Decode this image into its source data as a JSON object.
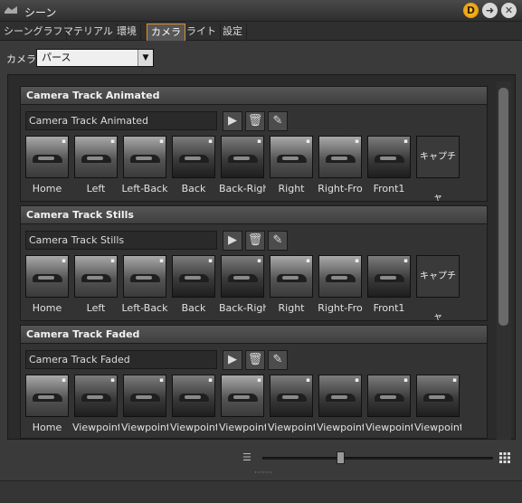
{
  "window": {
    "title": "シーン",
    "help_badge": "D",
    "next_glyph": "➜",
    "close_glyph": "✕"
  },
  "tabs": [
    {
      "label": "シーングラフ"
    },
    {
      "label": "マテリアル"
    },
    {
      "label": "環境"
    },
    {
      "label": "カメラ"
    },
    {
      "label": "ライト"
    },
    {
      "label": "設定"
    }
  ],
  "active_tab": "カメラ",
  "camera": {
    "label": "カメラ",
    "selected": "パース"
  },
  "groups": [
    {
      "title": "Camera Track Animated",
      "track_name": "Camera Track Animated",
      "thumbnails": [
        {
          "label": "Home"
        },
        {
          "label": "Left"
        },
        {
          "label": "Left-Back"
        },
        {
          "label": "Back"
        },
        {
          "label": "Back-Righ"
        },
        {
          "label": "Right"
        },
        {
          "label": "Right-Fro"
        },
        {
          "label": "Front1"
        }
      ],
      "capture_label": "キャプチャ"
    },
    {
      "title": "Camera Track Stills",
      "track_name": "Camera Track Stills",
      "thumbnails": [
        {
          "label": "Home"
        },
        {
          "label": "Left"
        },
        {
          "label": "Left-Back"
        },
        {
          "label": "Back"
        },
        {
          "label": "Back-Righ"
        },
        {
          "label": "Right"
        },
        {
          "label": "Right-Fro"
        },
        {
          "label": "Front1"
        }
      ],
      "capture_label": "キャプチャ"
    },
    {
      "title": "Camera Track Faded",
      "track_name": "Camera Track Faded",
      "thumbnails": [
        {
          "label": "Home"
        },
        {
          "label": "Viewpoint"
        },
        {
          "label": "Viewpoint"
        },
        {
          "label": "Viewpoint"
        },
        {
          "label": "Viewpoint"
        },
        {
          "label": "Viewpoint"
        },
        {
          "label": "Viewpoint"
        },
        {
          "label": "Viewpoint"
        },
        {
          "label": "Viewpoint"
        }
      ]
    }
  ],
  "icons": {
    "play": "play-icon",
    "delete": "trash-icon",
    "edit": "wrench-icon",
    "list_view": "list-icon",
    "grid_view": "grid-icon"
  },
  "thumbnail_zoom": 0.34,
  "colors": {
    "active_tab_border": "#e0902a",
    "help_badge": "#f5a800"
  }
}
